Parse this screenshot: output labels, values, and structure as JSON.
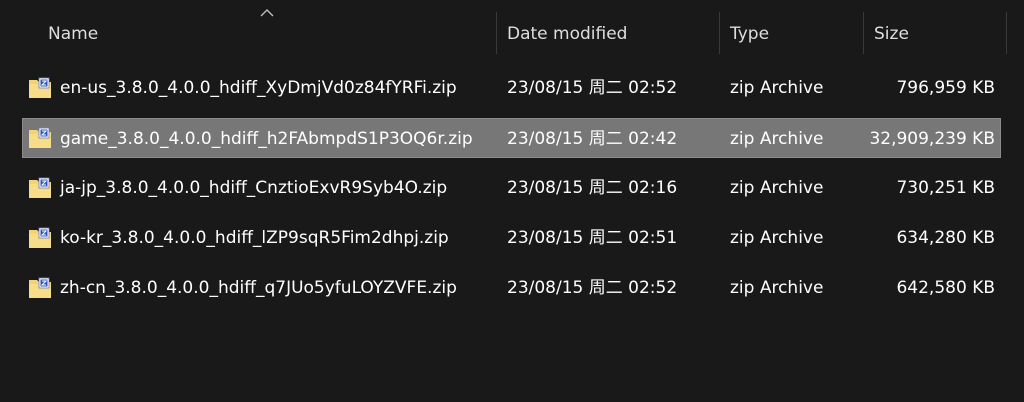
{
  "columns": {
    "name": "Name",
    "date": "Date modified",
    "type": "Type",
    "size": "Size"
  },
  "sort": {
    "column": "name",
    "direction": "ascending"
  },
  "files": [
    {
      "name": "en-us_3.8.0_4.0.0_hdiff_XyDmjVd0z84fYRFi.zip",
      "date": "23/08/15 周二 02:52",
      "type": "zip Archive",
      "size": "796,959 KB",
      "selected": false
    },
    {
      "name": "game_3.8.0_4.0.0_hdiff_h2FAbmpdS1P3OQ6r.zip",
      "date": "23/08/15 周二 02:42",
      "type": "zip Archive",
      "size": "32,909,239 KB",
      "selected": true
    },
    {
      "name": "ja-jp_3.8.0_4.0.0_hdiff_CnztioExvR9Syb4O.zip",
      "date": "23/08/15 周二 02:16",
      "type": "zip Archive",
      "size": "730,251 KB",
      "selected": false
    },
    {
      "name": "ko-kr_3.8.0_4.0.0_hdiff_lZP9sqR5Fim2dhpj.zip",
      "date": "23/08/15 周二 02:51",
      "type": "zip Archive",
      "size": "634,280 KB",
      "selected": false
    },
    {
      "name": "zh-cn_3.8.0_4.0.0_hdiff_q7JUo5yfuLOYZVFE.zip",
      "date": "23/08/15 周二 02:52",
      "type": "zip Archive",
      "size": "642,580 KB",
      "selected": false
    }
  ],
  "colors": {
    "background": "#191919",
    "selection": "#777777",
    "folder": "#f3d37a",
    "zip_badge": "#2b55c7"
  },
  "icons": {
    "file": "zip-folder-icon",
    "sort": "sort-ascending-icon"
  }
}
